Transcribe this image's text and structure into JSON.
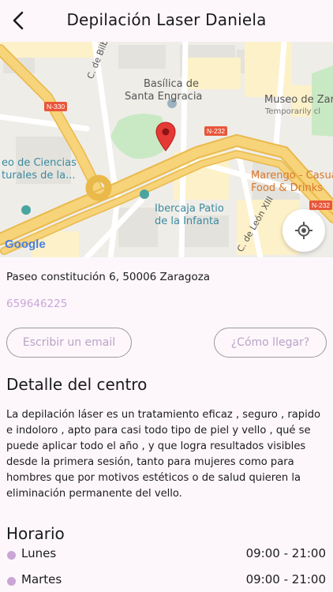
{
  "header": {
    "title": "Depilación Laser Daniela",
    "back_icon": "chevron-left-icon"
  },
  "map": {
    "labels": {
      "c_bilbao": "C. de Bilbao",
      "basilica_1": "Basílica de",
      "basilica_2": "Santa Engracia",
      "museo": "Museo de Zara",
      "temporarily": "Temporarily cl",
      "ciencias_1": "eo de Ciencias",
      "ciencias_2": "turales de la...",
      "marengo_1": "Marengo - Casual",
      "marengo_2": "Food & Drinks",
      "ibercaja_1": "Ibercaja Patio",
      "ibercaja_2": "de la Infanta",
      "c_leon": "C. de León XIII",
      "google": "Google"
    },
    "shields": {
      "n330": "N-330",
      "n232a": "N-232",
      "n232b": "N-232"
    },
    "colors": {
      "road": "#f7d37a",
      "road_edge": "#e9b94a",
      "park": "#c9e9c4",
      "poi_text": "#3a8aa0",
      "food_text": "#d9762b",
      "pin": "#e53935"
    },
    "locate_icon": "my-location-icon"
  },
  "contact": {
    "address": "Paseo constitución 6, 50006 Zaragoza",
    "phone": "659646225",
    "email_button": "Escribir un email",
    "directions_button": "¿Cómo llegar?"
  },
  "detail": {
    "title": "Detalle del centro",
    "lines": [
      "La depilación láser es un tratamiento eficaz , seguro , rapido",
      "e indoloro , apto para casi todo tipo de piel y vello , qué se",
      "puede aplicar todo el año , y que logra resultados visibles",
      "desde la primera sesión, tanto para mujeres como para",
      "hombres que por motivos estéticos o de salud quieren la",
      "eliminación permanente del vello."
    ]
  },
  "schedule": {
    "title": "Horario",
    "rows": [
      {
        "day": "Lunes",
        "hours": "09:00 - 21:00"
      },
      {
        "day": "Martes",
        "hours": "09:00 - 21:00"
      }
    ]
  }
}
